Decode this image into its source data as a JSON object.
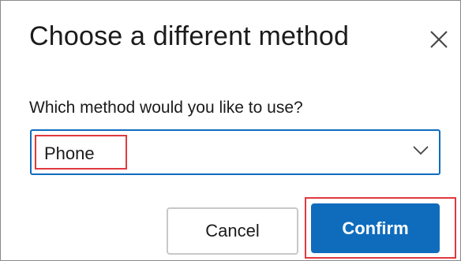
{
  "dialog": {
    "title": "Choose a different method",
    "close_icon": "close-icon"
  },
  "form": {
    "label": "Which method would you like to use?",
    "select": {
      "value": "Phone",
      "icon": "chevron-down-icon"
    }
  },
  "buttons": {
    "cancel_label": "Cancel",
    "confirm_label": "Confirm"
  },
  "colors": {
    "accent": "#0f6cbd",
    "highlight": "#e0393e"
  }
}
